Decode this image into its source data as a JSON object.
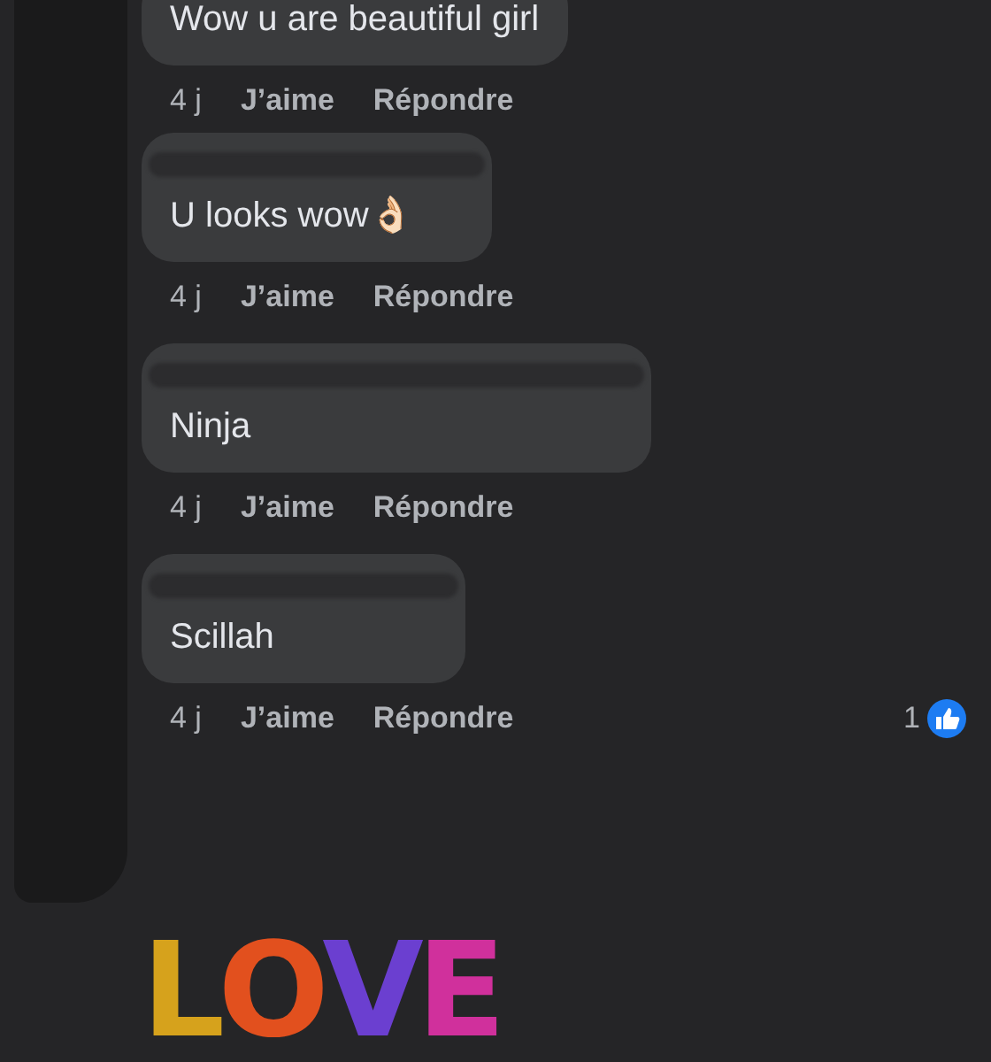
{
  "comments": [
    {
      "name_redacted": false,
      "text": "Wow u are beautiful girl",
      "time": "4 j",
      "like_label": "J’aime",
      "reply_label": "Répondre"
    },
    {
      "name_redacted": true,
      "text": "U looks wow👌🏻",
      "time": "4 j",
      "like_label": "J’aime",
      "reply_label": "Répondre"
    },
    {
      "name_redacted": true,
      "text": "Ninja",
      "time": "4 j",
      "like_label": "J’aime",
      "reply_label": "Répondre"
    },
    {
      "name_redacted": true,
      "text": "Scillah",
      "time": "4 j",
      "like_label": "J’aime",
      "reply_label": "Répondre",
      "reaction_count": "1"
    }
  ],
  "sticker": {
    "text": "LOVE"
  }
}
